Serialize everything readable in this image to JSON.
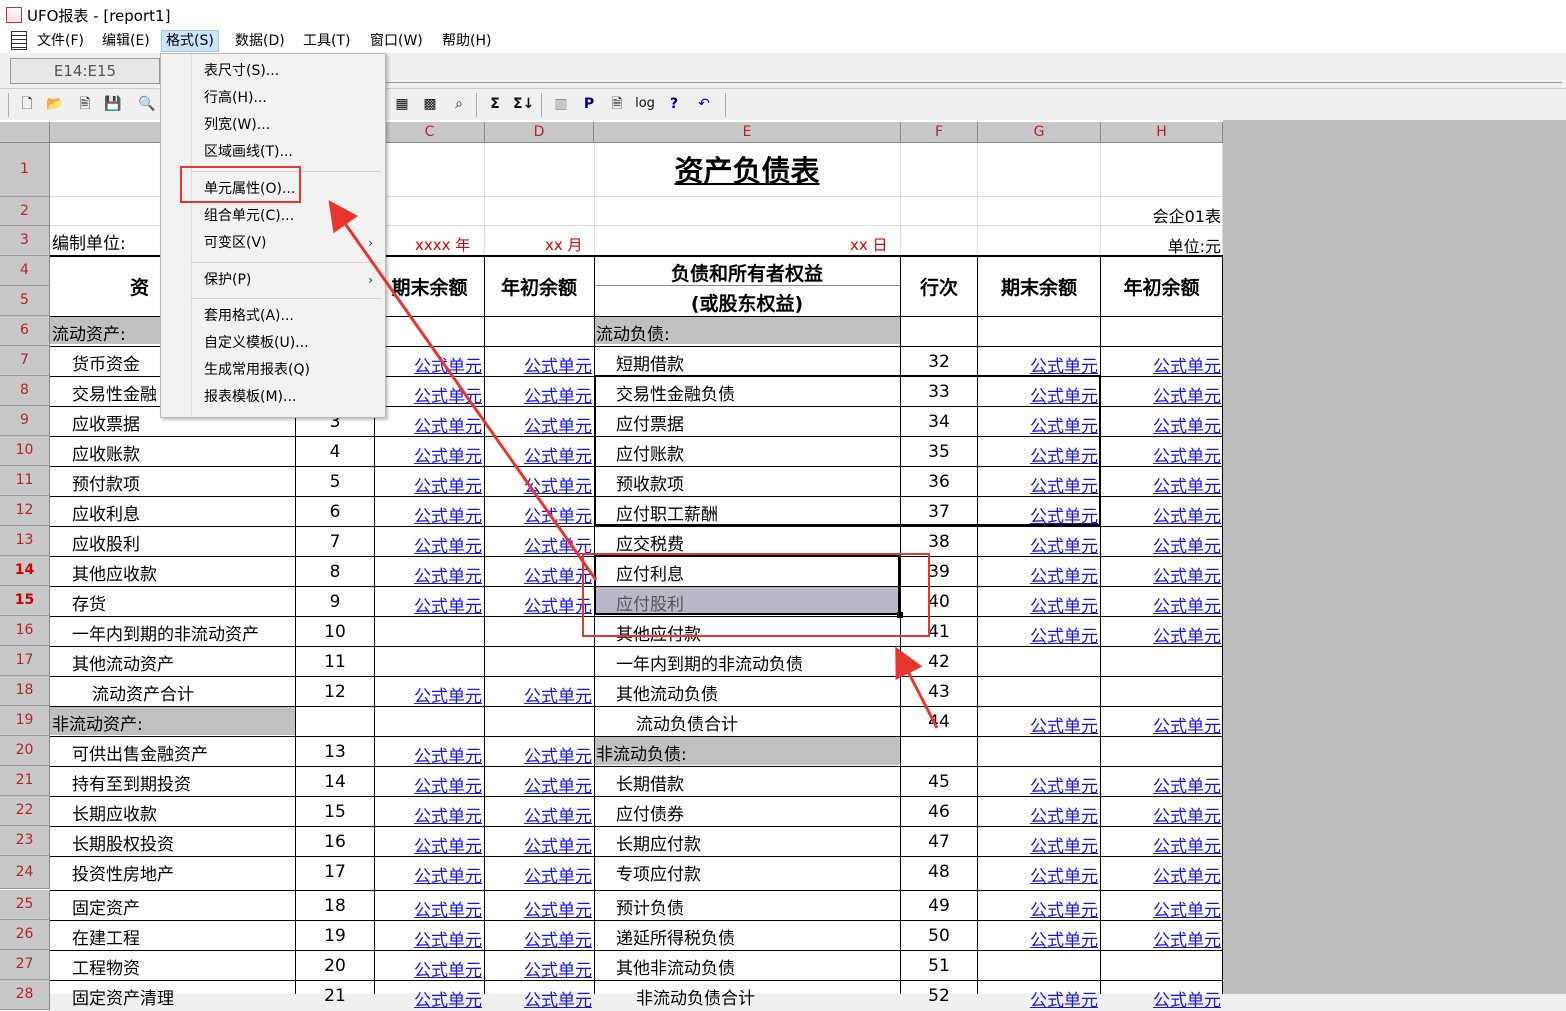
{
  "window": {
    "title": "UFO报表 - [report1]"
  },
  "menu": [
    "文件(F)",
    "编辑(E)",
    "格式(S)",
    "数据(D)",
    "工具(T)",
    "窗口(W)",
    "帮助(H)"
  ],
  "namebox": "E14:E15",
  "format_menu": {
    "items": [
      "表尺寸(S)...",
      "行高(H)...",
      "列宽(W)...",
      "区域画线(T)...",
      "单元属性(O)...",
      "组合单元(C)...",
      "可变区(V)",
      "保护(P)",
      "套用格式(A)...",
      "自定义模板(U)...",
      "生成常用报表(Q)",
      "报表模板(M)..."
    ],
    "highlighted": "单元属性(O)..."
  },
  "toolbar": {
    "icons": [
      "new-icon",
      "open-icon",
      "print-icon",
      "save-icon",
      "preview-icon",
      "table-icon",
      "grid-icon",
      "find-icon",
      "sum-icon",
      "sum-all-icon",
      "chart-icon",
      "p-icon",
      "page-icon",
      "log-icon",
      "help-icon",
      "undo-icon"
    ],
    "labels": {
      "p": "P",
      "log": "log",
      "help": "?",
      "sum": "Σ",
      "sum2": "Σ↓"
    }
  },
  "columns": [
    "C",
    "D",
    "E",
    "F",
    "G",
    "H"
  ],
  "sheet": {
    "title": "资产负债表",
    "form_code": "会企01表",
    "unit_label": "编制单位:",
    "year": "xxxx 年",
    "month": "xx 月",
    "day": "xx 日",
    "unit": "单位:元",
    "headers": {
      "asset": "资",
      "end_balance": "期末余额",
      "begin_balance": "年初余额",
      "liab_line1": "负债和所有者权益",
      "liab_line2": "(或股东权益)",
      "line_no": "行次"
    },
    "formula_label": "公式单元",
    "left_rows": [
      {
        "row": "6",
        "name": "流动资产:",
        "no": ""
      },
      {
        "row": "7",
        "name": "货币资金",
        "no": ""
      },
      {
        "row": "8",
        "name": "交易性金融",
        "no": ""
      },
      {
        "row": "9",
        "name": "应收票据",
        "no": "3"
      },
      {
        "row": "10",
        "name": "应收账款",
        "no": "4"
      },
      {
        "row": "11",
        "name": "预付款项",
        "no": "5"
      },
      {
        "row": "12",
        "name": "应收利息",
        "no": "6"
      },
      {
        "row": "13",
        "name": "应收股利",
        "no": "7"
      },
      {
        "row": "14",
        "name": "其他应收款",
        "no": "8"
      },
      {
        "row": "15",
        "name": "存货",
        "no": "9"
      },
      {
        "row": "16",
        "name": "一年内到期的非流动资产",
        "no": "10"
      },
      {
        "row": "17",
        "name": "其他流动资产",
        "no": "11"
      },
      {
        "row": "18",
        "name": "流动资产合计",
        "no": "12"
      },
      {
        "row": "19",
        "name": "非流动资产:",
        "no": ""
      },
      {
        "row": "20",
        "name": "可供出售金融资产",
        "no": "13"
      },
      {
        "row": "21",
        "name": "持有至到期投资",
        "no": "14"
      },
      {
        "row": "22",
        "name": "长期应收款",
        "no": "15"
      },
      {
        "row": "23",
        "name": "长期股权投资",
        "no": "16"
      },
      {
        "row": "24",
        "name": "投资性房地产",
        "no": "17"
      },
      {
        "row": "25",
        "name": "固定资产",
        "no": "18"
      },
      {
        "row": "26",
        "name": "在建工程",
        "no": "19"
      },
      {
        "row": "27",
        "name": "工程物资",
        "no": "20"
      },
      {
        "row": "28",
        "name": "固定资产清理",
        "no": "21"
      }
    ],
    "right_rows": [
      {
        "name": "流动负债:",
        "no": ""
      },
      {
        "name": "短期借款",
        "no": "32"
      },
      {
        "name": "交易性金融负债",
        "no": "33"
      },
      {
        "name": "应付票据",
        "no": "34"
      },
      {
        "name": "应付账款",
        "no": "35"
      },
      {
        "name": "预收款项",
        "no": "36"
      },
      {
        "name": "应付职工薪酬",
        "no": "37"
      },
      {
        "name": "应交税费",
        "no": "38"
      },
      {
        "name": "应付利息",
        "no": "39"
      },
      {
        "name": "应付股利",
        "no": "40"
      },
      {
        "name": "其他应付款",
        "no": "41"
      },
      {
        "name": "一年内到期的非流动负债",
        "no": "42"
      },
      {
        "name": "其他流动负债",
        "no": "43"
      },
      {
        "name": "流动负债合计",
        "no": "44"
      },
      {
        "name": "非流动负债:",
        "no": ""
      },
      {
        "name": "长期借款",
        "no": "45"
      },
      {
        "name": "应付债券",
        "no": "46"
      },
      {
        "name": "长期应付款",
        "no": "47"
      },
      {
        "name": "专项应付款",
        "no": "48"
      },
      {
        "name": "预计负债",
        "no": "49"
      },
      {
        "name": "递延所得税负债",
        "no": "50"
      },
      {
        "name": "其他非流动负债",
        "no": "51"
      },
      {
        "name": "非流动负债合计",
        "no": "52"
      }
    ]
  },
  "colors": {
    "formula": "#1515e8",
    "header_red": "#b22222",
    "highlight_box": "#e8352e",
    "selection": "#b8b8c8"
  }
}
